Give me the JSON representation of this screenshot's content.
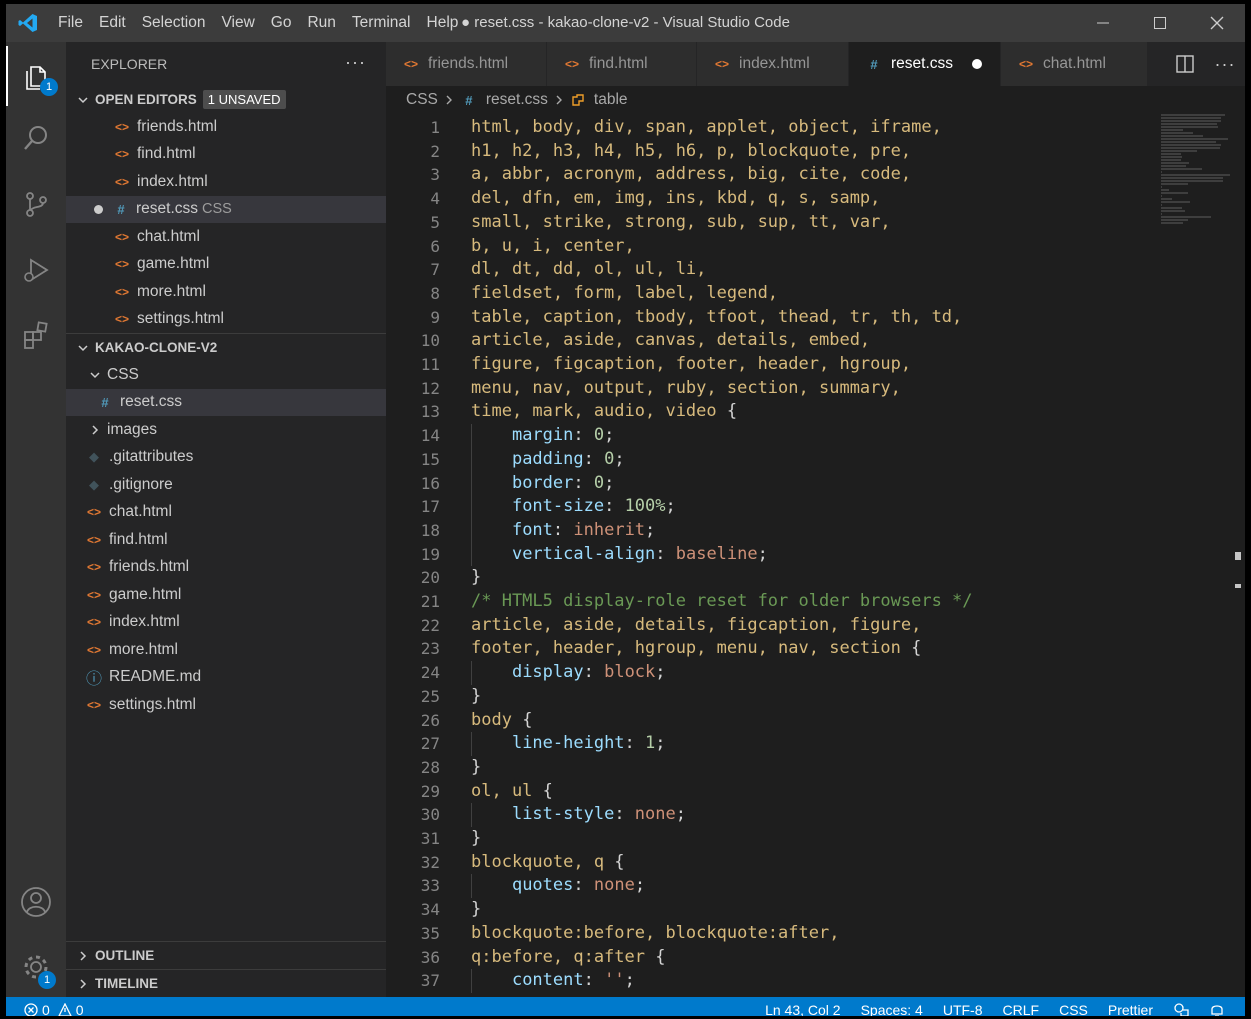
{
  "window": {
    "title": "● reset.css - kakao-clone-v2 - Visual Studio Code",
    "menu": [
      "File",
      "Edit",
      "Selection",
      "View",
      "Go",
      "Run",
      "Terminal",
      "Help"
    ],
    "controls": [
      "minimize-icon",
      "maximize-icon",
      "close-icon"
    ]
  },
  "activity_bar": {
    "items": [
      {
        "name": "explorer",
        "icon": "files-icon",
        "badge": "1"
      },
      {
        "name": "search",
        "icon": "search-icon"
      },
      {
        "name": "source-control",
        "icon": "source-control-icon"
      },
      {
        "name": "run",
        "icon": "run-debug-icon"
      },
      {
        "name": "extensions",
        "icon": "extensions-icon"
      }
    ],
    "bottom": [
      {
        "name": "accounts",
        "icon": "account-icon"
      },
      {
        "name": "manage",
        "icon": "gear-icon",
        "badge": "1"
      }
    ]
  },
  "sidebar": {
    "title": "EXPLORER",
    "more": "···",
    "open_editors": {
      "label": "OPEN EDITORS",
      "badge": "1 UNSAVED",
      "items": [
        {
          "name": "friends.html",
          "type": "html"
        },
        {
          "name": "find.html",
          "type": "html"
        },
        {
          "name": "index.html",
          "type": "html"
        },
        {
          "name": "reset.css",
          "type": "css",
          "desc": "CSS",
          "dirty": true
        },
        {
          "name": "chat.html",
          "type": "html"
        },
        {
          "name": "game.html",
          "type": "html"
        },
        {
          "name": "more.html",
          "type": "html"
        },
        {
          "name": "settings.html",
          "type": "html"
        }
      ]
    },
    "project": {
      "label": "KAKAO-CLONE-V2",
      "folder_css": "CSS",
      "folder_css_child": "reset.css",
      "folder_images": "images",
      "files": [
        {
          "name": ".gitattributes",
          "type": "git"
        },
        {
          "name": ".gitignore",
          "type": "git"
        },
        {
          "name": "chat.html",
          "type": "html"
        },
        {
          "name": "find.html",
          "type": "html"
        },
        {
          "name": "friends.html",
          "type": "html"
        },
        {
          "name": "game.html",
          "type": "html"
        },
        {
          "name": "index.html",
          "type": "html"
        },
        {
          "name": "more.html",
          "type": "html"
        },
        {
          "name": "README.md",
          "type": "info"
        },
        {
          "name": "settings.html",
          "type": "html"
        }
      ]
    },
    "outline": "OUTLINE",
    "timeline": "TIMELINE"
  },
  "tabs": [
    {
      "label": "friends.html",
      "type": "html"
    },
    {
      "label": "find.html",
      "type": "html"
    },
    {
      "label": "index.html",
      "type": "html"
    },
    {
      "label": "reset.css",
      "type": "css",
      "active": true,
      "dirty": true
    },
    {
      "label": "chat.html",
      "type": "html"
    }
  ],
  "breadcrumb": [
    "CSS",
    "reset.css",
    "table"
  ],
  "code_lines": [
    [
      [
        "sel",
        "html, body, div, span, applet, object, iframe,"
      ]
    ],
    [
      [
        "sel",
        "h1, h2, h3, h4, h5, h6, p, blockquote, pre,"
      ]
    ],
    [
      [
        "sel",
        "a, abbr, acronym, address, big, cite, code,"
      ]
    ],
    [
      [
        "sel",
        "del, dfn, em, img, ins, kbd, q, s, samp,"
      ]
    ],
    [
      [
        "sel",
        "small, strike, strong, sub, sup, tt, var,"
      ]
    ],
    [
      [
        "sel",
        "b, u, i, center,"
      ]
    ],
    [
      [
        "sel",
        "dl, dt, dd, ol, ul, li,"
      ]
    ],
    [
      [
        "sel",
        "fieldset, form, label, legend,"
      ]
    ],
    [
      [
        "sel",
        "table, caption, tbody, tfoot, thead, tr, th, td,"
      ]
    ],
    [
      [
        "sel",
        "article, aside, canvas, details, embed,"
      ]
    ],
    [
      [
        "sel",
        "figure, figcaption, footer, header, hgroup,"
      ]
    ],
    [
      [
        "sel",
        "menu, nav, output, ruby, section, summary,"
      ]
    ],
    [
      [
        "sel",
        "time, mark, audio, video "
      ],
      [
        "punc",
        "{"
      ]
    ],
    [
      [
        "punc",
        "    "
      ],
      [
        "prop",
        "margin"
      ],
      [
        "punc",
        ": "
      ],
      [
        "num",
        "0"
      ],
      [
        "punc",
        ";"
      ]
    ],
    [
      [
        "punc",
        "    "
      ],
      [
        "prop",
        "padding"
      ],
      [
        "punc",
        ": "
      ],
      [
        "num",
        "0"
      ],
      [
        "punc",
        ";"
      ]
    ],
    [
      [
        "punc",
        "    "
      ],
      [
        "prop",
        "border"
      ],
      [
        "punc",
        ": "
      ],
      [
        "num",
        "0"
      ],
      [
        "punc",
        ";"
      ]
    ],
    [
      [
        "punc",
        "    "
      ],
      [
        "prop",
        "font-size"
      ],
      [
        "punc",
        ": "
      ],
      [
        "num",
        "100%"
      ],
      [
        "punc",
        ";"
      ]
    ],
    [
      [
        "punc",
        "    "
      ],
      [
        "prop",
        "font"
      ],
      [
        "punc",
        ": "
      ],
      [
        "val",
        "inherit"
      ],
      [
        "punc",
        ";"
      ]
    ],
    [
      [
        "punc",
        "    "
      ],
      [
        "prop",
        "vertical-align"
      ],
      [
        "punc",
        ": "
      ],
      [
        "val",
        "baseline"
      ],
      [
        "punc",
        ";"
      ]
    ],
    [
      [
        "punc",
        "}"
      ]
    ],
    [
      [
        "cmt",
        "/* HTML5 display-role reset for older browsers */"
      ]
    ],
    [
      [
        "sel",
        "article, aside, details, figcaption, figure,"
      ]
    ],
    [
      [
        "sel",
        "footer, header, hgroup, menu, nav, section "
      ],
      [
        "punc",
        "{"
      ]
    ],
    [
      [
        "punc",
        "    "
      ],
      [
        "prop",
        "display"
      ],
      [
        "punc",
        ": "
      ],
      [
        "val",
        "block"
      ],
      [
        "punc",
        ";"
      ]
    ],
    [
      [
        "punc",
        "}"
      ]
    ],
    [
      [
        "sel",
        "body "
      ],
      [
        "punc",
        "{"
      ]
    ],
    [
      [
        "punc",
        "    "
      ],
      [
        "prop",
        "line-height"
      ],
      [
        "punc",
        ": "
      ],
      [
        "num",
        "1"
      ],
      [
        "punc",
        ";"
      ]
    ],
    [
      [
        "punc",
        "}"
      ]
    ],
    [
      [
        "sel",
        "ol, ul "
      ],
      [
        "punc",
        "{"
      ]
    ],
    [
      [
        "punc",
        "    "
      ],
      [
        "prop",
        "list-style"
      ],
      [
        "punc",
        ": "
      ],
      [
        "val",
        "none"
      ],
      [
        "punc",
        ";"
      ]
    ],
    [
      [
        "punc",
        "}"
      ]
    ],
    [
      [
        "sel",
        "blockquote, q "
      ],
      [
        "punc",
        "{"
      ]
    ],
    [
      [
        "punc",
        "    "
      ],
      [
        "prop",
        "quotes"
      ],
      [
        "punc",
        ": "
      ],
      [
        "val",
        "none"
      ],
      [
        "punc",
        ";"
      ]
    ],
    [
      [
        "punc",
        "}"
      ]
    ],
    [
      [
        "sel",
        "blockquote:before, blockquote:after,"
      ]
    ],
    [
      [
        "sel",
        "q:before, q:after "
      ],
      [
        "punc",
        "{"
      ]
    ],
    [
      [
        "punc",
        "    "
      ],
      [
        "prop",
        "content"
      ],
      [
        "punc",
        ": "
      ],
      [
        "val",
        "''"
      ],
      [
        "punc",
        ";"
      ]
    ]
  ],
  "status": {
    "errors": "0",
    "warnings": "0",
    "position": "Ln 43, Col 2",
    "spaces": "Spaces: 4",
    "encoding": "UTF-8",
    "eol": "CRLF",
    "language": "CSS",
    "formatter": "Prettier"
  },
  "colors": {
    "accent": "#007acc",
    "selector": "#d7ba7d",
    "property": "#9cdcfe",
    "number": "#b5cea8",
    "value": "#ce9178",
    "comment": "#6a9955"
  }
}
